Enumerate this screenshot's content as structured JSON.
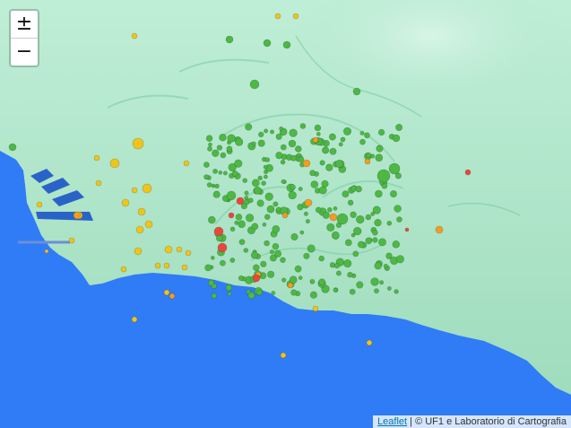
{
  "map": {
    "zoom_in_label": "±",
    "zoom_out_label": "−",
    "attribution": {
      "link_label": "Leaflet",
      "separator": " | ",
      "text": "© UF1 e Laboratorio di Cartografia"
    },
    "colors": {
      "sea": "#2f7cf6",
      "land": "#a9e4c8",
      "land_dark": "#7fcfa5",
      "harbor": "#2a63c8",
      "green_marker": "#4db844",
      "yellow_marker": "#f0c419",
      "orange_marker": "#f39c1f",
      "red_marker": "#e8483b"
    },
    "legend_categories": [
      "green",
      "yellow",
      "orange",
      "red"
    ]
  }
}
